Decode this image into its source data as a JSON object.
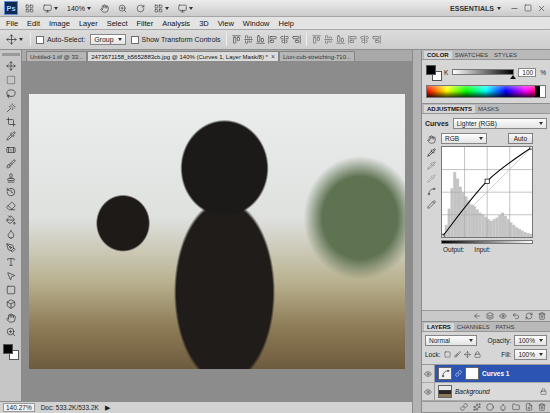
{
  "app_bar": {
    "logo": "Ps",
    "zoom": "140%",
    "workspace": "ESSENTIALS"
  },
  "menu": [
    "File",
    "Edit",
    "Image",
    "Layer",
    "Select",
    "Filter",
    "Analysis",
    "3D",
    "View",
    "Window",
    "Help"
  ],
  "options_bar": {
    "auto_select": {
      "label": "Auto-Select:",
      "checked": false
    },
    "auto_select_target": "Group",
    "transform_controls": {
      "label": "Show Transform Controls",
      "checked": false
    }
  },
  "tools": {
    "foreground": "#000000",
    "background": "#ffffff"
  },
  "document_tabs": [
    {
      "label": "Untitled-1.tif @ 33...",
      "selected": false,
      "close": ""
    },
    {
      "label": "2473671158_b5652883cb.jpg @ 140% (Curves 1, Layer Mask/8) *",
      "selected": true,
      "close": "×"
    },
    {
      "label": "Lion-cub-stretching-710...",
      "selected": false,
      "close": ""
    }
  ],
  "status_bar": {
    "zoom": "140.27%",
    "doc": "Doc: 533.2K/533.2K",
    "arrow": "▶"
  },
  "color_panel": {
    "tabs": [
      {
        "label": "COLOR",
        "selected": true
      },
      {
        "label": "SWATCHES",
        "selected": false
      },
      {
        "label": "STYLES",
        "selected": false
      }
    ],
    "foreground": "#000000",
    "background": "#ffffff",
    "channel": "K",
    "level": 1,
    "value": "100",
    "unit": "%"
  },
  "adjustments_panel": {
    "tabs": [
      {
        "label": "ADJUSTMENTS",
        "selected": true
      },
      {
        "label": "MASKS",
        "selected": false
      }
    ],
    "type": "Curves",
    "preset": "Lighter (RGB)",
    "channel": "RGB",
    "auto_button": "Auto",
    "output_label": "Output:",
    "input_label": "Input:",
    "curve_points": [
      [
        0,
        0
      ],
      [
        128,
        158
      ],
      [
        255,
        255
      ]
    ],
    "histogram": [
      0.05,
      0.15,
      0.35,
      0.6,
      0.8,
      0.72,
      0.62,
      0.55,
      0.5,
      0.45,
      0.4,
      0.38,
      0.34,
      0.3,
      0.28,
      0.25,
      0.22,
      0.2,
      0.22,
      0.24,
      0.27,
      0.3,
      0.26,
      0.22,
      0.18,
      0.15,
      0.12,
      0.1,
      0.08,
      0.06,
      0.05,
      0.04
    ]
  },
  "layers_panel": {
    "tabs": [
      {
        "label": "LAYERS",
        "selected": true
      },
      {
        "label": "CHANNELS",
        "selected": false
      },
      {
        "label": "PATHS",
        "selected": false
      }
    ],
    "blend_mode": "Normal",
    "opacity_label": "Opacity:",
    "opacity": "100%",
    "lock_label": "Lock:",
    "fill_label": "Fill:",
    "fill": "100%",
    "layers": [
      {
        "name": "Curves 1",
        "kind": "adjustment",
        "selected": true,
        "visible": true,
        "locked": false
      },
      {
        "name": "Background",
        "kind": "background",
        "selected": false,
        "visible": true,
        "locked": true
      }
    ]
  }
}
